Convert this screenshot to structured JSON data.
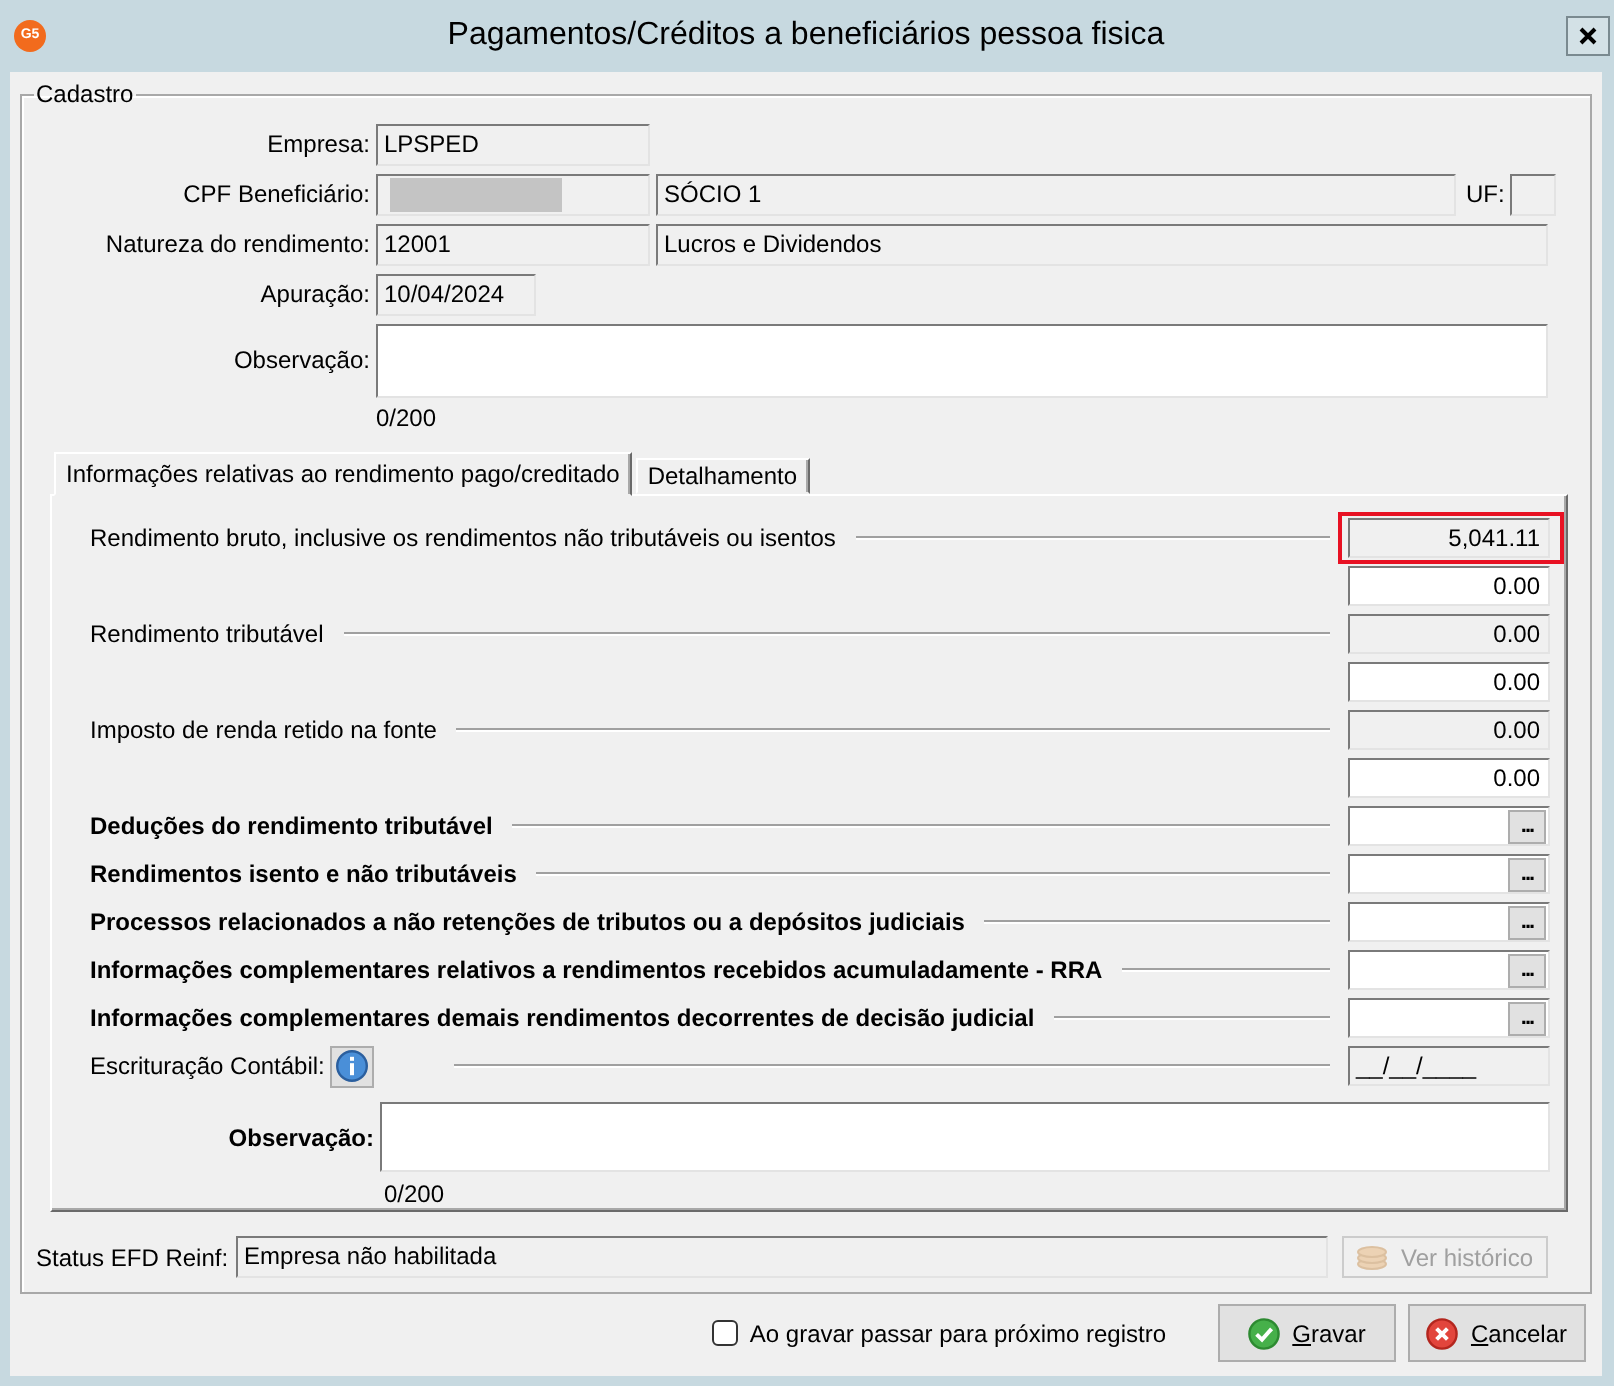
{
  "window": {
    "title": "Pagamentos/Créditos a beneficiários pessoa fisica",
    "logo_text": "G5"
  },
  "cadastro": {
    "legend": "Cadastro",
    "empresa": {
      "label": "Empresa:",
      "value": "LPSPED"
    },
    "cpf": {
      "label": "CPF Beneficiário:",
      "redacted": true,
      "name": "SÓCIO 1",
      "uf_label": "UF:"
    },
    "natureza": {
      "label": "Natureza do rendimento:",
      "code": "12001",
      "description": "Lucros e Dividendos"
    },
    "apuracao": {
      "label": "Apuração:",
      "value": "10/04/2024"
    },
    "observacao": {
      "label": "Observação:",
      "counter": "0/200"
    },
    "tabs": [
      {
        "label": "Informações relativas ao rendimento pago/creditado",
        "selected": true
      },
      {
        "label": "Detalhamento",
        "selected": false
      }
    ],
    "panel": {
      "amounts": [
        {
          "label": "Rendimento bruto, inclusive os rendimentos não tributáveis ou isentos",
          "computed": "5,041.11",
          "input": "0.00",
          "highlighted": true
        },
        {
          "label": "Rendimento tributável",
          "computed": "0.00",
          "input": "0.00",
          "highlighted": false
        },
        {
          "label": "Imposto de renda retido na fonte",
          "computed": "0.00",
          "input": "0.00",
          "highlighted": false
        }
      ],
      "details": [
        {
          "label": "Deduções do rendimento tributável",
          "button": "..."
        },
        {
          "label": "Rendimentos isento e não tributáveis",
          "button": "..."
        },
        {
          "label": "Processos relacionados a não retenções de tributos ou a depósitos judiciais",
          "button": "..."
        },
        {
          "label": "Informações complementares relativos a rendimentos recebidos acumuladamente - RRA",
          "button": "..."
        },
        {
          "label": "Informações complementares demais rendimentos decorrentes de decisão judicial",
          "button": "..."
        }
      ],
      "escrituracao": {
        "label": "Escrituração Contábil:",
        "date": "__/__/____"
      },
      "observacao": {
        "label": "Observação:",
        "counter": "0/200"
      }
    },
    "status": {
      "label": "Status EFD Reinf:",
      "value": "Empresa não habilitada",
      "history_button": {
        "label": "Ver histórico",
        "disabled": true
      }
    }
  },
  "footer": {
    "checkbox": {
      "label": "Ao gravar passar para próximo registro",
      "checked": false
    },
    "buttons": [
      {
        "kind": "save",
        "label": "Gravar"
      },
      {
        "kind": "cancel",
        "label": "Cancelar"
      }
    ]
  }
}
